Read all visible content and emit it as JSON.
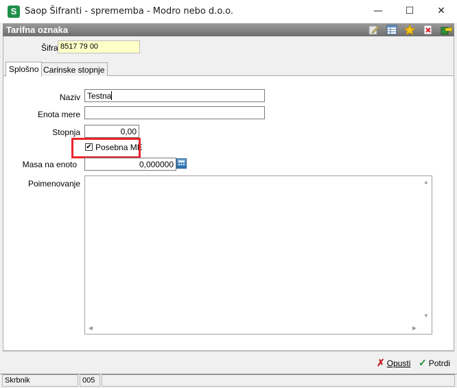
{
  "window": {
    "app_icon": "S",
    "title": "Saop Šifranti - sprememba - Modro nebo d.o.o.",
    "minimize": "—",
    "maximize": "☐",
    "close": "✕"
  },
  "header": {
    "title": "Tarifna oznaka",
    "toolbar_icons": [
      "edit-icon",
      "table-icon",
      "star-icon",
      "delete-icon",
      "exit-icon"
    ]
  },
  "sifra": {
    "label": "Šifra",
    "value": "8517 79 00",
    "bg_color": "#ffffc8"
  },
  "tabs": [
    {
      "label": "Splošno",
      "active": true
    },
    {
      "label": "Carinske stopnje",
      "active": false
    }
  ],
  "form": {
    "naziv": {
      "label": "Naziv",
      "value": "Testna"
    },
    "enota_mere": {
      "label": "Enota mere",
      "value": ""
    },
    "stopnja": {
      "label": "Stopnja",
      "value": "0,00"
    },
    "posebna_me": {
      "label": "Posebna ME",
      "checked": true,
      "check_glyph": "✔"
    },
    "masa_na_enoto": {
      "label": "Masa na enoto",
      "value": "0,000000"
    },
    "poimenovanje": {
      "label": "Poimenovanje",
      "value": ""
    }
  },
  "buttons": {
    "opusti": {
      "label": "Opusti",
      "icon_glyph": "✗",
      "color": "#c0202a"
    },
    "potrdi": {
      "label": "Potrdi",
      "icon_glyph": "✓",
      "color": "#1f8f2a"
    }
  },
  "statusbar": {
    "user": "Skrbnik",
    "code": "005"
  },
  "highlight_color": "#e8262d"
}
